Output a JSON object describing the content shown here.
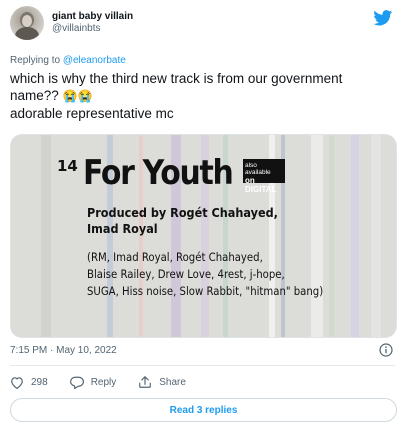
{
  "author": {
    "display_name": "giant baby villain",
    "handle": "@villainbts",
    "avatar_icon": "avatar-image"
  },
  "reply_context": {
    "prefix": "Replying to ",
    "mention": "@eleanorbate"
  },
  "tweet": {
    "line1": "which is why the third new track is from our government",
    "line2": "name?? ",
    "emoji": "😭😭",
    "line3": "adorable representative mc"
  },
  "media": {
    "track_number": "14",
    "track_title": "For Youth",
    "badge_line1": "also available",
    "badge_line2": "on DIGITAL",
    "produced_lines": [
      "Produced by Rogét Chahayed,",
      "Imad Royal"
    ],
    "credit_lines": [
      "(RM, Imad Royal, Rogét Chahayed,",
      "Blaise Railey, Drew Love, 4rest, j-hope,",
      "SUGA, Hiss noise, Slow Rabbit, \"hitman\" bang)"
    ]
  },
  "meta": {
    "timestamp": "7:15 PM · May 10, 2022"
  },
  "actions": {
    "like_count": "298",
    "reply_label": "Reply",
    "share_label": "Share"
  },
  "read_replies_label": "Read 3 replies",
  "colors": {
    "accent": "#1d9bf0",
    "text_primary": "#0f1419",
    "text_secondary": "#536471"
  }
}
